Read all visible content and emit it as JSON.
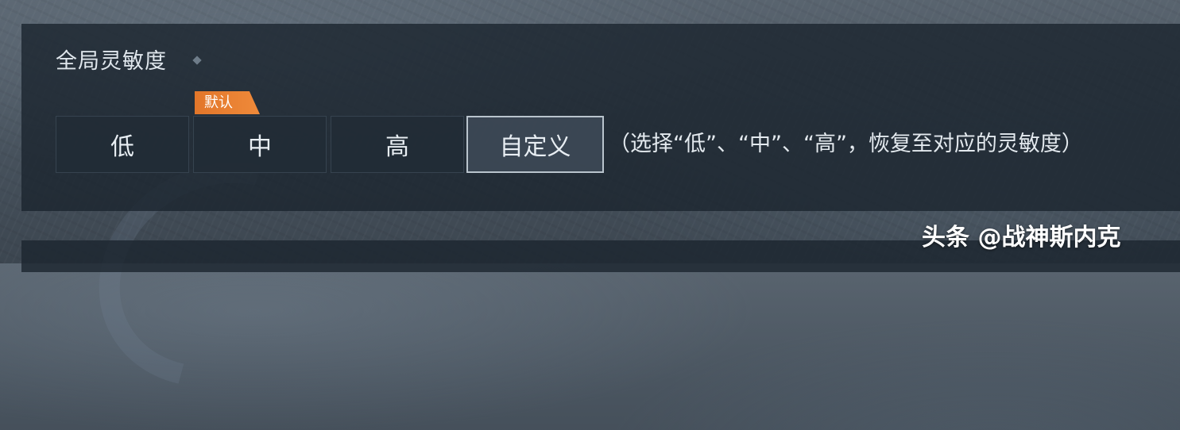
{
  "section": {
    "title": "全局灵敏度"
  },
  "sensitivity": {
    "options": [
      {
        "label": "低",
        "selected": false
      },
      {
        "label": "中",
        "selected": false,
        "badge": "默认"
      },
      {
        "label": "高",
        "selected": false
      },
      {
        "label": "自定义",
        "selected": true
      }
    ],
    "hint": "（选择“低”、“中”、“高”，恢复至对应的灵敏度）"
  },
  "watermark": {
    "text": "头条 @战神斯内克"
  },
  "colors": {
    "badge": "#e8802f",
    "panel": "#1c2630",
    "selected_border": "#b9c4cd"
  }
}
